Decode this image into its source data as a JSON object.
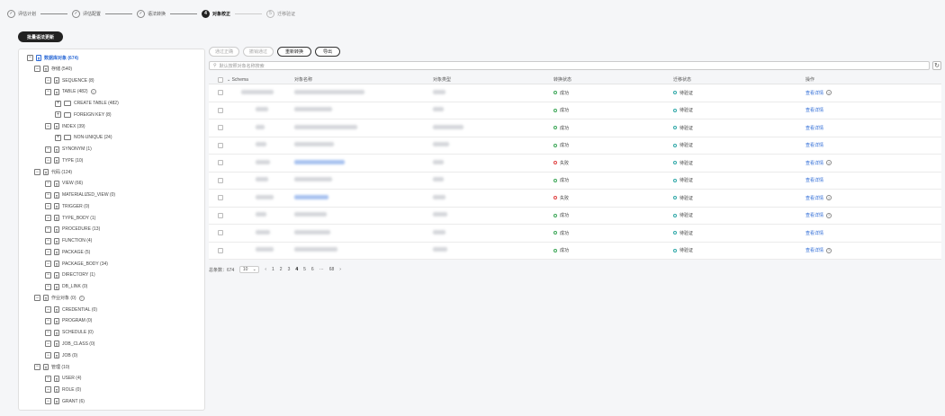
{
  "stepper": {
    "steps": [
      {
        "label": "评估计划",
        "state": "done"
      },
      {
        "label": "评估配置",
        "state": "done"
      },
      {
        "label": "语法转换",
        "state": "done"
      },
      {
        "label": "对象校正",
        "state": "active",
        "number": "4"
      },
      {
        "label": "迁移验证",
        "state": "todo",
        "number": "5"
      }
    ]
  },
  "batch_button": "批量语法更新",
  "tree": {
    "nodes": [
      {
        "label": "数据库对象 (674)",
        "level": 0,
        "toggle": "−",
        "root": true
      },
      {
        "label": "存储 (540)",
        "level": 1,
        "toggle": "−"
      },
      {
        "label": "SEQUENCE (8)",
        "level": 2,
        "toggle": "−"
      },
      {
        "label": "TABLE (482)",
        "level": 2,
        "toggle": "−",
        "help": true
      },
      {
        "label": "CREATE TABLE (482)",
        "level": 3,
        "toggle": "+",
        "folder": true
      },
      {
        "label": "FOREIGN KEY (8)",
        "level": 3,
        "toggle": "+",
        "folder": true
      },
      {
        "label": "INDEX (39)",
        "level": 2,
        "toggle": "−"
      },
      {
        "label": "NON-UNIQUE (24)",
        "level": 3,
        "toggle": "+",
        "folder": true
      },
      {
        "label": "SYNONYM (1)",
        "level": 2,
        "toggle": "−"
      },
      {
        "label": "TYPE (10)",
        "level": 2,
        "toggle": "−"
      },
      {
        "label": "代码 (124)",
        "level": 1,
        "toggle": "−"
      },
      {
        "label": "VIEW (66)",
        "level": 2,
        "toggle": "−"
      },
      {
        "label": "MATERIALIZED_VIEW (0)",
        "level": 2,
        "toggle": "−"
      },
      {
        "label": "TRIGGER (0)",
        "level": 2,
        "toggle": "−"
      },
      {
        "label": "TYPE_BODY (1)",
        "level": 2,
        "toggle": "−"
      },
      {
        "label": "PROCEDURE (13)",
        "level": 2,
        "toggle": "−"
      },
      {
        "label": "FUNCTION (4)",
        "level": 2,
        "toggle": "−"
      },
      {
        "label": "PACKAGE (5)",
        "level": 2,
        "toggle": "−"
      },
      {
        "label": "PACKAGE_BODY (34)",
        "level": 2,
        "toggle": "−"
      },
      {
        "label": "DIRECTORY (1)",
        "level": 2,
        "toggle": "−"
      },
      {
        "label": "DB_LINK (0)",
        "level": 2,
        "toggle": "−"
      },
      {
        "label": "作业对象 (0)",
        "level": 1,
        "toggle": "−",
        "help": true
      },
      {
        "label": "CREDENTIAL (0)",
        "level": 2,
        "toggle": "−"
      },
      {
        "label": "PROGRAM (0)",
        "level": 2,
        "toggle": "−"
      },
      {
        "label": "SCHEDULE (0)",
        "level": 2,
        "toggle": "−"
      },
      {
        "label": "JOB_CLASS (0)",
        "level": 2,
        "toggle": "−"
      },
      {
        "label": "JOB (0)",
        "level": 2,
        "toggle": "−"
      },
      {
        "label": "管理 (10)",
        "level": 1,
        "toggle": "−"
      },
      {
        "label": "USER (4)",
        "level": 2,
        "toggle": "−"
      },
      {
        "label": "ROLE (0)",
        "level": 2,
        "toggle": "−"
      },
      {
        "label": "GRANT (6)",
        "level": 2,
        "toggle": "−"
      }
    ]
  },
  "toolbar": {
    "buttons": [
      {
        "label": "通过正确",
        "enabled": false
      },
      {
        "label": "撤销通过",
        "enabled": false
      },
      {
        "label": "重新转换",
        "enabled": true
      },
      {
        "label": "导出",
        "enabled": true
      }
    ]
  },
  "search": {
    "placeholder": "默认按照对象名称搜索"
  },
  "table": {
    "headers": {
      "schema": "Schema",
      "name": "对象名称",
      "type": "对象类型",
      "conv": "转换状态",
      "mig": "迁移状态",
      "op": "操作"
    },
    "rows": [
      {
        "conv": "成功",
        "conv_state": "ok",
        "mig": "待验证",
        "op": "查看详情",
        "help": true,
        "name_link": false
      },
      {
        "conv": "成功",
        "conv_state": "ok",
        "mig": "待验证",
        "op": "查看详情",
        "help": false,
        "name_link": false
      },
      {
        "conv": "成功",
        "conv_state": "ok",
        "mig": "待验证",
        "op": "查看详情",
        "help": false,
        "name_link": false
      },
      {
        "conv": "成功",
        "conv_state": "ok",
        "mig": "待验证",
        "op": "查看详情",
        "help": false,
        "name_link": false
      },
      {
        "conv": "失败",
        "conv_state": "fail",
        "mig": "待验证",
        "op": "查看详情",
        "help": true,
        "name_link": true
      },
      {
        "conv": "成功",
        "conv_state": "ok",
        "mig": "待验证",
        "op": "查看详情",
        "help": false,
        "name_link": false
      },
      {
        "conv": "失败",
        "conv_state": "fail",
        "mig": "待验证",
        "op": "查看详情",
        "help": true,
        "name_link": true
      },
      {
        "conv": "成功",
        "conv_state": "ok",
        "mig": "待验证",
        "op": "查看详情",
        "help": true,
        "name_link": false
      },
      {
        "conv": "成功",
        "conv_state": "ok",
        "mig": "待验证",
        "op": "查看详情",
        "help": false,
        "name_link": false
      },
      {
        "conv": "成功",
        "conv_state": "ok",
        "mig": "待验证",
        "op": "查看详情",
        "help": true,
        "name_link": false
      }
    ]
  },
  "pager": {
    "total": "总条数：674",
    "size": "10",
    "pages": [
      "1",
      "2",
      "3",
      "4",
      "5",
      "6",
      "···",
      "68"
    ],
    "active": "4"
  },
  "colors": {
    "accent": "#2c6ad6",
    "success": "#3aa655",
    "fail": "#e04040",
    "wait": "#2ea8a8"
  }
}
